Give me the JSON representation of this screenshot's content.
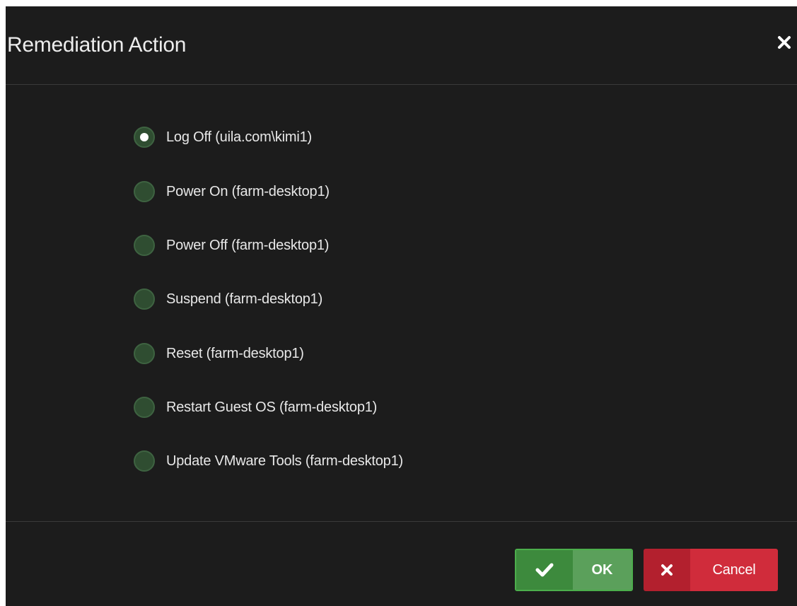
{
  "dialog": {
    "title": "Remediation Action",
    "close_icon": "close-icon"
  },
  "options": [
    {
      "label": "Log Off (uila.com\\kimi1)",
      "checked": true
    },
    {
      "label": "Power On (farm-desktop1)",
      "checked": false
    },
    {
      "label": "Power Off (farm-desktop1)",
      "checked": false
    },
    {
      "label": "Suspend (farm-desktop1)",
      "checked": false
    },
    {
      "label": "Reset (farm-desktop1)",
      "checked": false
    },
    {
      "label": "Restart Guest OS (farm-desktop1)",
      "checked": false
    },
    {
      "label": "Update VMware Tools (farm-desktop1)",
      "checked": false
    }
  ],
  "footer": {
    "ok_label": "OK",
    "ok_icon": "check-icon",
    "cancel_label": "Cancel",
    "cancel_icon": "x-icon"
  },
  "colors": {
    "background": "#1c1c1c",
    "radio_fill": "#2f4d31",
    "ok_green": "#5ba05b",
    "cancel_red": "#d02c3b"
  }
}
